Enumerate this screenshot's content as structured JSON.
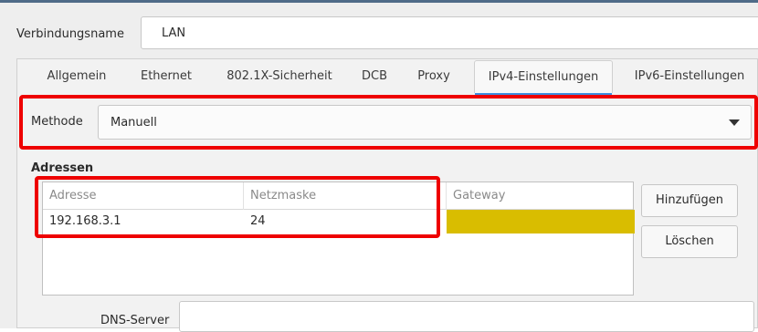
{
  "connection": {
    "name_label": "Verbindungsname",
    "name_value": "LAN"
  },
  "tabs": [
    {
      "label": "Allgemein"
    },
    {
      "label": "Ethernet"
    },
    {
      "label": "802.1X-Sicherheit"
    },
    {
      "label": "DCB"
    },
    {
      "label": "Proxy"
    },
    {
      "label": "IPv4-Einstellungen",
      "active": true
    },
    {
      "label": "IPv6-Einstellungen"
    }
  ],
  "method": {
    "label": "Methode",
    "value": "Manuell"
  },
  "addresses": {
    "title": "Adressen",
    "columns": [
      "Adresse",
      "Netzmaske",
      "Gateway"
    ],
    "rows": [
      {
        "address": "192.168.3.1",
        "netmask": "24",
        "gateway": ""
      }
    ],
    "add_button": "Hinzufügen",
    "delete_button": "Löschen"
  },
  "dns": {
    "label": "DNS-Server",
    "value": ""
  },
  "colors": {
    "highlight_red": "#ee0000",
    "tab_underline": "#3d8ee0",
    "gateway_cell": "#d9bd00"
  }
}
